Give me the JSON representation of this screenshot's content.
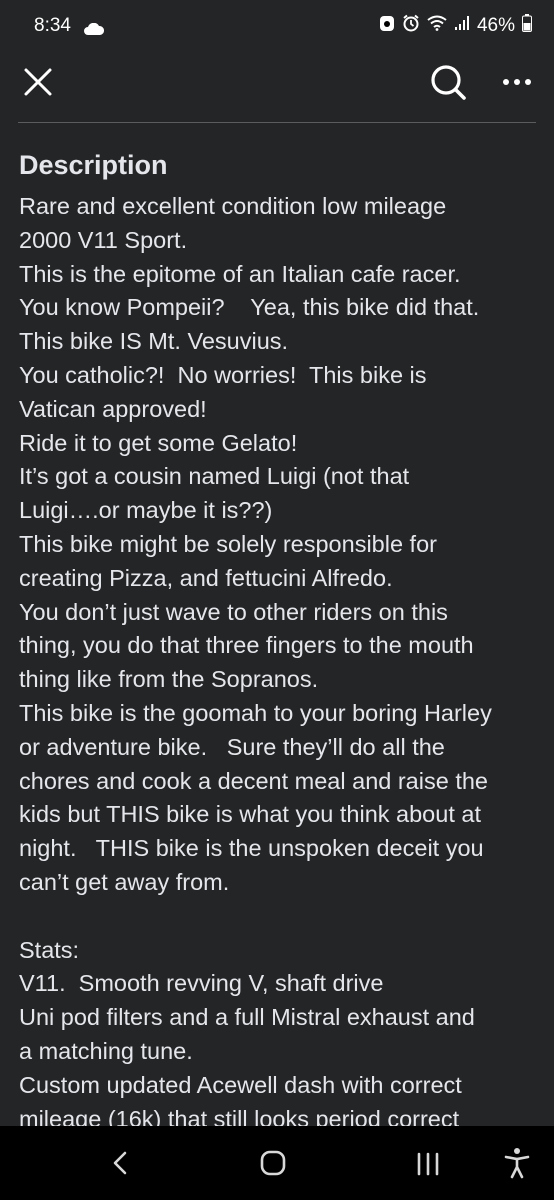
{
  "status_bar": {
    "time": "8:34",
    "battery_percent": "46%"
  },
  "header": {
    "close_icon": "close-icon",
    "search_icon": "search-icon",
    "more_icon": "more-icon"
  },
  "description": {
    "heading": "Description",
    "lines": [
      "Rare and excellent condition low mileage",
      "2000 V11 Sport.",
      "This is the epitome of an Italian cafe racer.",
      "You know Pompeii?    Yea, this bike did that.",
      "This bike IS Mt. Vesuvius.",
      "You catholic?!  No worries!  This bike is",
      "Vatican approved!",
      "Ride it to get some Gelato!",
      "It’s got a cousin named Luigi (not that",
      "Luigi….or maybe it is??)",
      "This bike might be solely responsible for",
      "creating Pizza, and fettucini Alfredo.",
      "You don’t just wave to other riders on this",
      "thing, you do that three fingers to the mouth",
      "thing like from the Sopranos.",
      "This bike is the goomah to your boring Harley",
      "or adventure bike.   Sure they’ll do all the",
      "chores and cook a decent meal and raise the",
      "kids but THIS bike is what you think about at",
      "night.   THIS bike is the unspoken deceit you",
      "can’t get away from.",
      "",
      "Stats:",
      "V11.  Smooth revving V, shaft drive",
      "Uni pod filters and a full Mistral exhaust and",
      "a matching tune.",
      "Custom updated Acewell dash with correct",
      "mileage (16k) that still looks period correct"
    ]
  },
  "nav": {
    "back_icon": "back-icon",
    "home_icon": "home-icon",
    "recents_icon": "recents-icon",
    "accessibility_icon": "accessibility-icon"
  }
}
